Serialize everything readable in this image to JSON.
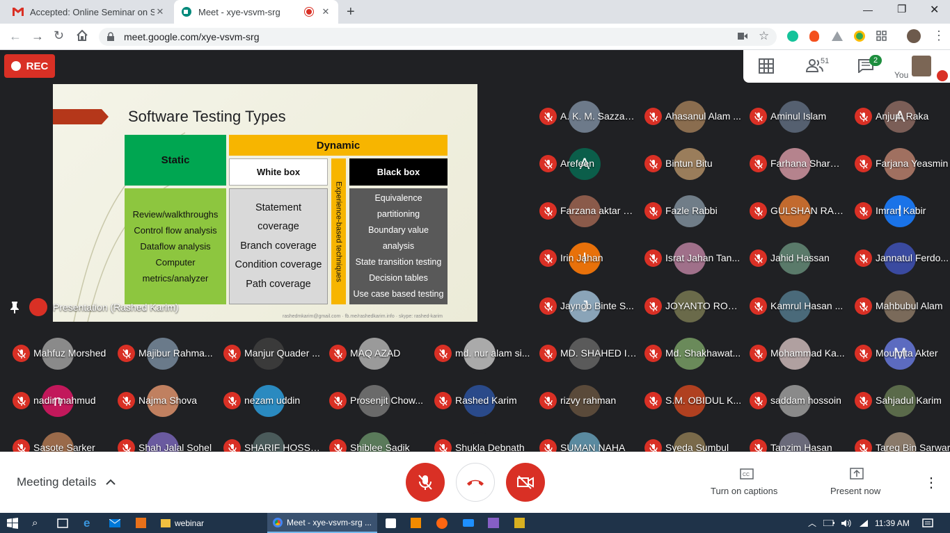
{
  "browser": {
    "tabs": [
      {
        "title": "Accepted: Online Seminar on Sof",
        "icon": "gmail-icon"
      },
      {
        "title": "Meet - xye-vsvm-srg",
        "icon": "meet-icon"
      }
    ],
    "url": "meet.google.com/xye-vsvm-srg"
  },
  "meet": {
    "rec_label": "REC",
    "people_count": "51",
    "chat_count": "2",
    "self_label": "You",
    "presentation_label": "Presentation (Rashed Karim)",
    "meeting_details": "Meeting details",
    "captions_label": "Turn on captions",
    "present_label": "Present now"
  },
  "slide": {
    "title": "Software Testing Types",
    "static": "Static",
    "dynamic": "Dynamic",
    "white_box": "White box",
    "black_box": "Black box",
    "experience": "Experience-based techniques",
    "static_items": [
      "Review/walkthroughs",
      "Control flow analysis",
      "Dataflow analysis",
      "Computer",
      "metrics/analyzer"
    ],
    "white_items": [
      "Statement",
      "coverage",
      "Branch coverage",
      "Condition coverage",
      "Path  coverage"
    ],
    "black_items": [
      "Equivalence",
      "partitioning",
      "Boundary value",
      "analysis",
      "State transition testing",
      "Decision tables",
      "Use case based testing"
    ],
    "footer": "rashedmkarim@gmail.com · fb.me/rashedkarim.info · skype: rashed-karim"
  },
  "participants": [
    {
      "name": "A. K. M. Sazzad...",
      "color": "#6d7a8a"
    },
    {
      "name": "Ahasanul Alam ...",
      "color": "#8a6d4f"
    },
    {
      "name": "Aminul Islam",
      "color": "#556070"
    },
    {
      "name": "Anjum Raka",
      "color": "#7b5e57",
      "initial": "A"
    },
    {
      "name": "Arefeen",
      "color": "#0b5e4a",
      "initial": "A"
    },
    {
      "name": "Bintun Bitu",
      "color": "#9a7d5b"
    },
    {
      "name": "Farhana Sharmi...",
      "color": "#b5838d"
    },
    {
      "name": "Farjana Yeasmin",
      "color": "#a07060"
    },
    {
      "name": "Farzana aktar B...",
      "color": "#8a5a4a"
    },
    {
      "name": "Fazle Rabbi",
      "color": "#707d88"
    },
    {
      "name": "GULSHAN RAH...",
      "color": "#c26a2e"
    },
    {
      "name": "Imran Kabir",
      "color": "#1a73e8",
      "initial": "I"
    },
    {
      "name": "Irin Jahan",
      "color": "#e8710a",
      "initial": "I"
    },
    {
      "name": "Israt Jahan Tan...",
      "color": "#a0708a"
    },
    {
      "name": "Jahid Hassan",
      "color": "#5a7a6a"
    },
    {
      "name": "Jannatul Ferdo...",
      "color": "#3a4aa0"
    },
    {
      "name": "Jaynob Binte S...",
      "color": "#8aa4b8",
      "initial": "J"
    },
    {
      "name": "JOYANTO ROY ...",
      "color": "#6a6a4a"
    },
    {
      "name": "Kamrul Hasan ...",
      "color": "#4a6a7a"
    },
    {
      "name": "Mahbubul Alam",
      "color": "#7a6a5a"
    },
    {
      "name": "Mahfuz Morshed",
      "color": "#8a8a8a"
    },
    {
      "name": "Majibur Rahma...",
      "color": "#6a7a8a"
    },
    {
      "name": "Manjur Quader ...",
      "color": "#3a3a3a"
    },
    {
      "name": "MAQ AZAD",
      "color": "#9a9a9a"
    },
    {
      "name": "md. nur alam si...",
      "color": "#aaaaaa"
    },
    {
      "name": "MD. SHAHED IS...",
      "color": "#5a5a5a"
    },
    {
      "name": "Md. Shakhawat...",
      "color": "#6a8a5a"
    },
    {
      "name": "Mohammad Ka...",
      "color": "#b0a0a0"
    },
    {
      "name": "Moumita Akter",
      "color": "#5c6bc0",
      "initial": "M"
    },
    {
      "name": "nadir mahmud",
      "color": "#c2185b",
      "initial": "n"
    },
    {
      "name": "Najma Shova",
      "color": "#c08060"
    },
    {
      "name": "nezam uddin",
      "color": "#2a8ac0"
    },
    {
      "name": "Prosenjit Chow...",
      "color": "#6a6a6a"
    },
    {
      "name": "Rashed Karim",
      "color": "#2a4a8a"
    },
    {
      "name": "rizvy rahman",
      "color": "#5a4a3a"
    },
    {
      "name": "S.M. OBIDUL K...",
      "color": "#b04020"
    },
    {
      "name": "saddam hossoin",
      "color": "#8a8a8a"
    },
    {
      "name": "Sahjadul Karim",
      "color": "#5a6a4a"
    },
    {
      "name": "Sasote Sarker",
      "color": "#9a6a4a"
    },
    {
      "name": "Shah Jalal Sohel",
      "color": "#6a5aa0"
    },
    {
      "name": "SHARIF HOSSA...",
      "color": "#4a5a5a"
    },
    {
      "name": "Shiblee Sadik",
      "color": "#5a7a5a"
    },
    {
      "name": "Shukla Debnath",
      "color": "#202124"
    },
    {
      "name": "SUMAN NAHA",
      "color": "#5a8aa0"
    },
    {
      "name": "Syeda Sumbul",
      "color": "#7a6a4a"
    },
    {
      "name": "Tanzim Hasan",
      "color": "#6a6a7a"
    },
    {
      "name": "Tareq Bin Sarwar",
      "color": "#8a7a6a"
    }
  ],
  "taskbar": {
    "webinar": "webinar",
    "chrome": "Meet - xye-vsvm-srg ...",
    "time": "11:39 AM"
  }
}
